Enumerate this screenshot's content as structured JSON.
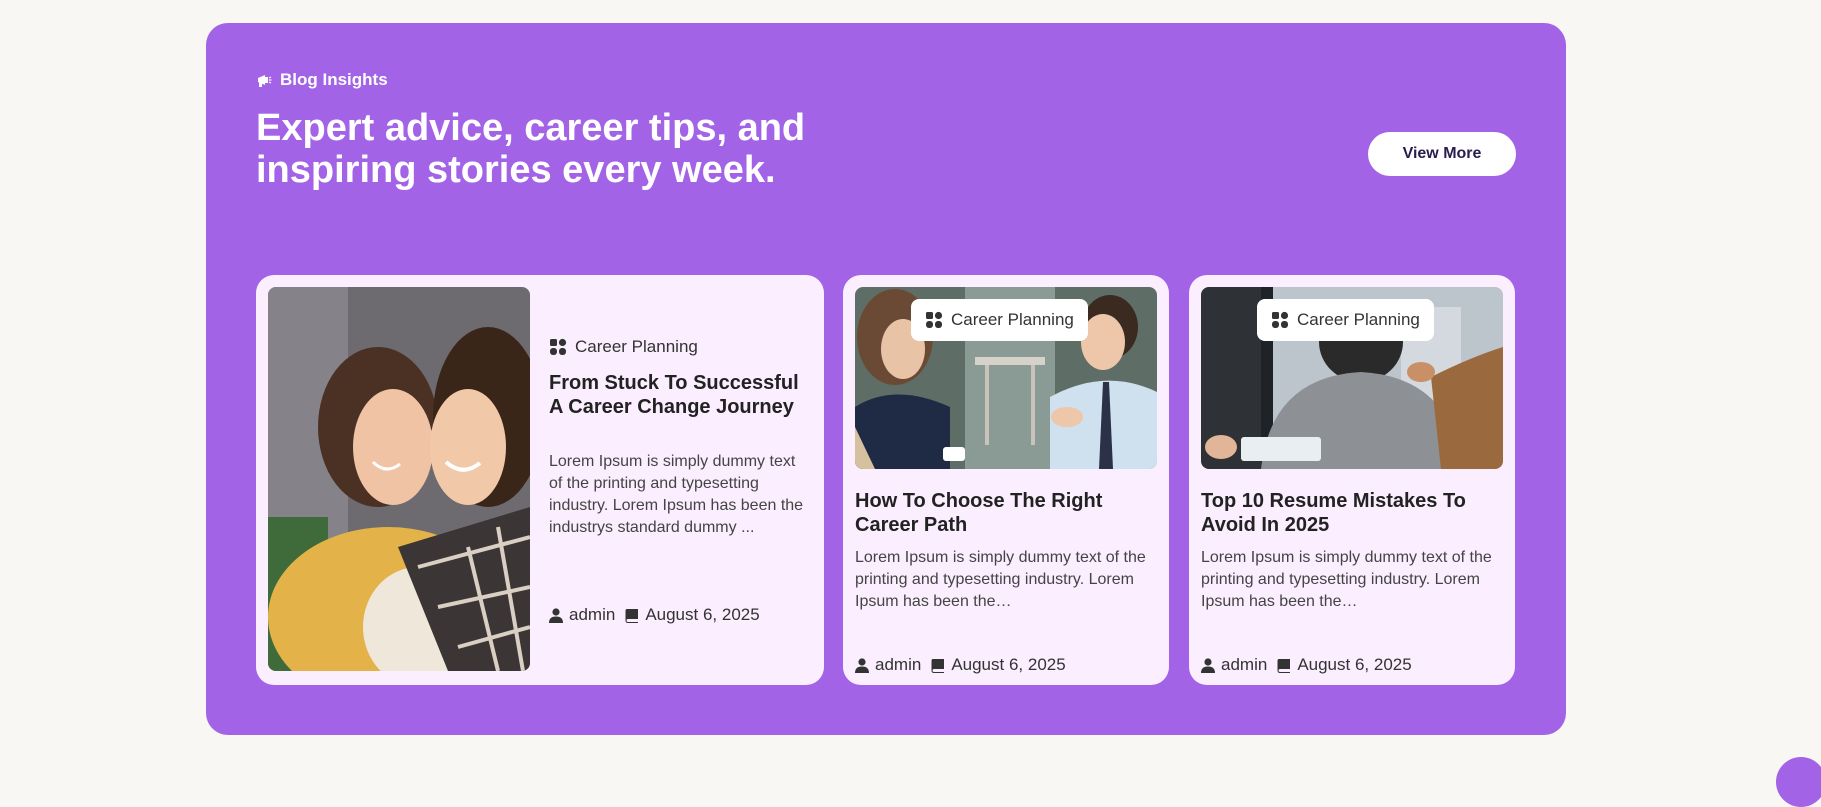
{
  "section": {
    "eyebrow": "Blog Insights",
    "headline": "Expert advice, career tips, and inspiring stories every week.",
    "view_more_label": "View More"
  },
  "posts": [
    {
      "category": "Career Planning",
      "title": "From Stuck To Successful A Career Change Journey",
      "excerpt": "Lorem Ipsum is simply dummy text of the printing and typesetting industry. Lorem Ipsum has been the industrys standard dummy ...",
      "author": "admin",
      "date": "August 6, 2025"
    },
    {
      "category": "Career Planning",
      "title": "How To Choose The Right Career Path",
      "excerpt": "Lorem Ipsum is simply dummy text of the printing and typesetting industry. Lorem Ipsum has been the…",
      "author": "admin",
      "date": "August 6, 2025"
    },
    {
      "category": "Career Planning",
      "title": "Top 10 Resume Mistakes To Avoid In 2025",
      "excerpt": "Lorem Ipsum is simply dummy text of the printing and typesetting industry. Lorem Ipsum has been the…",
      "author": "admin",
      "date": "August 6, 2025"
    }
  ],
  "colors": {
    "panel": "#a363e6",
    "card": "#fbeeff",
    "page": "#f8f7f3"
  },
  "icons": {
    "eyebrow": "megaphone-icon",
    "category": "grid-icon",
    "author": "user-icon",
    "date": "book-icon"
  }
}
